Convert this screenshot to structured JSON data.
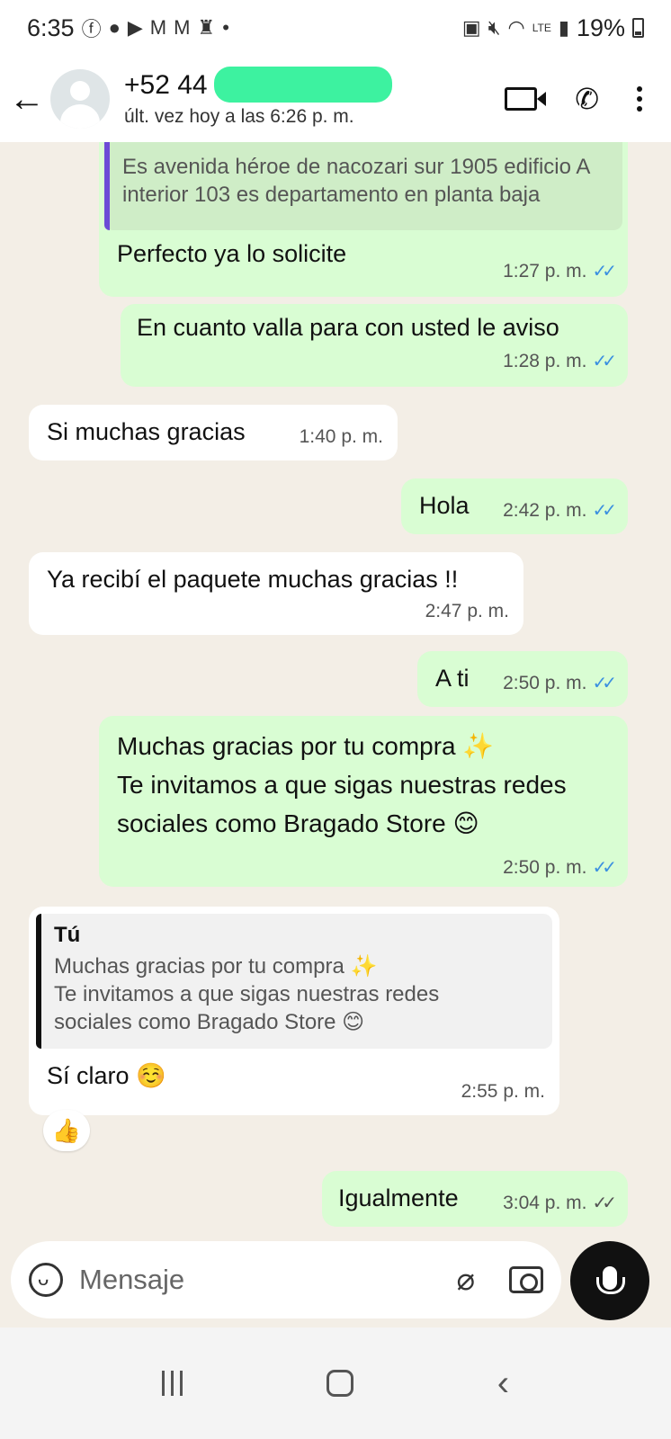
{
  "status_bar": {
    "time": "6:35",
    "battery": "19%",
    "icons": [
      "facebook-icon",
      "chat-icon",
      "youtube-icon",
      "gmail-icon",
      "gmail-icon",
      "keyhole-icon",
      "dot-icon",
      "nfc-icon",
      "mute-icon",
      "wifi-icon",
      "volte-icon",
      "signal-icon",
      "battery-icon"
    ]
  },
  "header": {
    "back_icon": "arrow-left-icon",
    "contact_name": "+52 44",
    "contact_status": "últ. vez hoy a las 6:26 p. m.",
    "actions": [
      "video-call-icon",
      "phone-icon",
      "more-vert-icon"
    ]
  },
  "messages": [
    {
      "direction": "out",
      "quote_text": "Es avenida héroe de nacozari sur 1905 edificio A interior 103 es departamento en planta baja",
      "text": "Perfecto ya lo solicite",
      "time": "1:27 p. m.",
      "status": "read"
    },
    {
      "direction": "out",
      "text": "En cuanto valla para con usted le aviso",
      "time": "1:28 p. m.",
      "status": "read"
    },
    {
      "direction": "in",
      "text": "Si muchas gracias",
      "time": "1:40 p. m."
    },
    {
      "direction": "out",
      "text": "Hola",
      "time": "2:42 p. m.",
      "status": "read"
    },
    {
      "direction": "in",
      "text": "Ya recibí el paquete muchas gracias !!",
      "time": "2:47 p. m."
    },
    {
      "direction": "out",
      "text": "A ti",
      "time": "2:50 p. m.",
      "status": "read"
    },
    {
      "direction": "out",
      "line1": "Muchas gracias por tu compra ✨",
      "line2": "Te invitamos a que sigas nuestras redes",
      "line3": "sociales como Bragado Store 😊",
      "time": "2:50 p. m.",
      "status": "read"
    },
    {
      "direction": "in",
      "quote_author": "Tú",
      "quote_line1": "Muchas gracias por tu compra ✨",
      "quote_line2": "Te invitamos a que sigas nuestras redes",
      "quote_line3": "sociales como Bragado Store 😊",
      "text": "Sí claro ☺️",
      "time": "2:55 p. m.",
      "reaction": "👍"
    },
    {
      "direction": "out",
      "text": "Igualmente",
      "time": "3:04 p. m.",
      "status": "delivered"
    }
  ],
  "composer": {
    "placeholder": "Mensaje",
    "icons": [
      "sticker-icon",
      "paperclip-icon",
      "camera-icon",
      "mic-icon"
    ]
  },
  "tick_glyph": "✓✓",
  "colors": {
    "outgoing_bubble": "#d9fdd3",
    "incoming_bubble": "#ffffff",
    "chat_background": "#f3eee6",
    "read_tick": "#3b8fe0",
    "quote_bar_out": "#6c4bd6",
    "quote_bar_in": "#111111",
    "redaction": "#3df2a0"
  }
}
